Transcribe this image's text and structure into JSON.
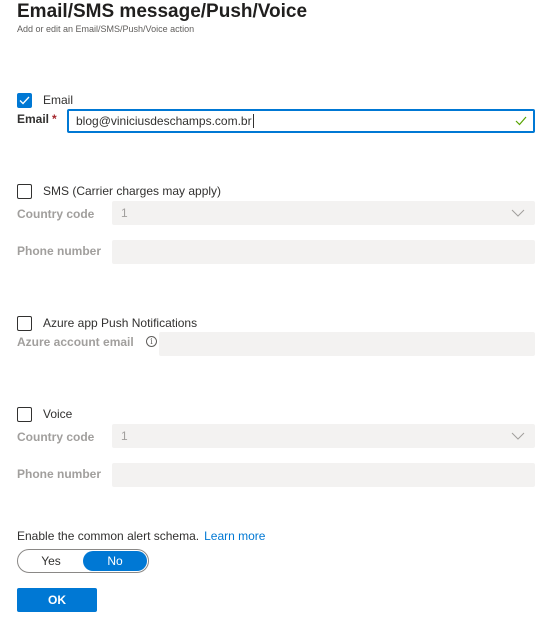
{
  "header": {
    "title": "Email/SMS message/Push/Voice",
    "subtitle": "Add or edit an Email/SMS/Push/Voice action"
  },
  "email": {
    "checkbox_label": "Email",
    "checked": true,
    "field_label": "Email",
    "required_marker": "*",
    "value": "blog@viniciusdeschamps.com.br",
    "valid": true
  },
  "sms": {
    "checkbox_label": "SMS (Carrier charges may apply)",
    "checked": false,
    "country_code_label": "Country code",
    "country_code_value": "1",
    "phone_label": "Phone number",
    "phone_value": ""
  },
  "push": {
    "checkbox_label": "Azure app Push Notifications",
    "checked": false,
    "account_email_label": "Azure account email",
    "info_glyph": "i",
    "account_email_value": ""
  },
  "voice": {
    "checkbox_label": "Voice",
    "checked": false,
    "country_code_label": "Country code",
    "country_code_value": "1",
    "phone_label": "Phone number",
    "phone_value": ""
  },
  "schema": {
    "label": "Enable the common alert schema.",
    "learn_more": "Learn more",
    "options": [
      "Yes",
      "No"
    ],
    "selected": "No"
  },
  "actions": {
    "ok_label": "OK"
  },
  "colors": {
    "accent": "#0078d4",
    "valid": "#57a300",
    "disabled_bg": "#f3f2f1"
  }
}
